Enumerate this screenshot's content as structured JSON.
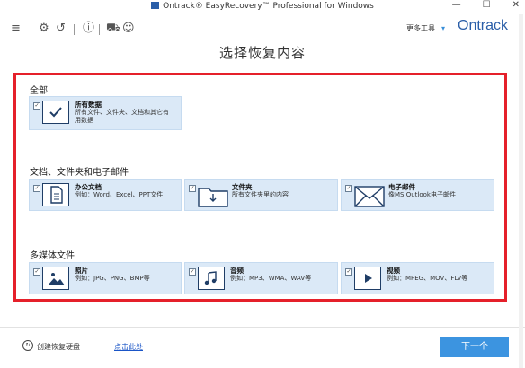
{
  "window": {
    "title": "Ontrack® EasyRecovery™ Professional for Windows",
    "minimize": "—",
    "maximize": "☐",
    "close": "✕"
  },
  "toolbar": {
    "more_tools": "更多工具",
    "brand": "Ontrack"
  },
  "main": {
    "title": "选择恢复内容"
  },
  "sections": {
    "all": "全部",
    "docs": "文档、文件夹和电子邮件",
    "media": "多媒体文件"
  },
  "cards": {
    "all_data": {
      "title": "所有数据",
      "desc": "所有文件、文件夹、文档和其它有用数据",
      "checked": true
    },
    "office": {
      "title": "办公文档",
      "desc": "例如：Word、Excel、PPT文件",
      "checked": true
    },
    "folder": {
      "title": "文件夹",
      "desc": "所有文件夹里的内容",
      "checked": true
    },
    "email": {
      "title": "电子邮件",
      "desc": "像MS Outlook电子邮件",
      "checked": true
    },
    "photo": {
      "title": "照片",
      "desc": "例如：JPG、PNG、BMP等",
      "checked": true
    },
    "audio": {
      "title": "音频",
      "desc": "例如：MP3、WMA、WAV等",
      "checked": true
    },
    "video": {
      "title": "视频",
      "desc": "例如：MPEG、MOV、FLV等",
      "checked": true
    }
  },
  "footer": {
    "create_label": "创建恢复硬盘",
    "link": "点击此处",
    "next": "下一个"
  }
}
